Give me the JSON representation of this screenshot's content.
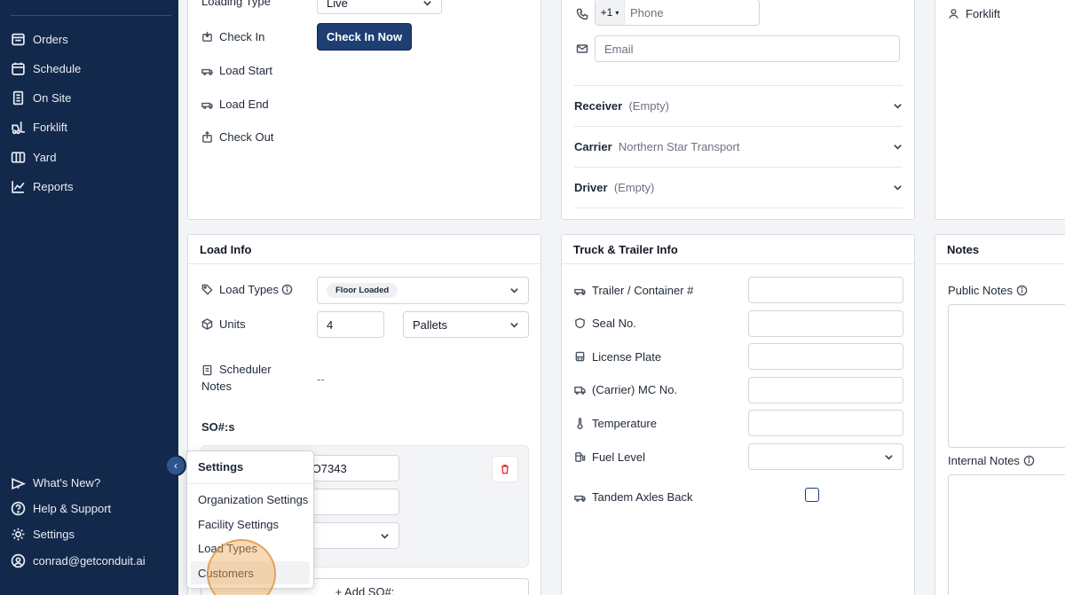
{
  "sidebar": {
    "items": [
      {
        "label": "Orders",
        "icon": "orders-icon"
      },
      {
        "label": "Schedule",
        "icon": "calendar-icon"
      },
      {
        "label": "On Site",
        "icon": "building-icon"
      },
      {
        "label": "Forklift",
        "icon": "forklift-icon"
      },
      {
        "label": "Yard",
        "icon": "yard-icon"
      },
      {
        "label": "Reports",
        "icon": "chart-line-icon"
      }
    ],
    "bottom": [
      {
        "label": "What's New?",
        "icon": "megaphone-icon"
      },
      {
        "label": "Help & Support",
        "icon": "help-circle-icon"
      },
      {
        "label": "Settings",
        "icon": "gear-icon"
      },
      {
        "label": "conrad@getconduit.ai",
        "icon": "user-circle-icon"
      }
    ],
    "collapse_glyph": "‹"
  },
  "top_left": {
    "loading_type_label": "Loading Type",
    "loading_type_value": "Live",
    "check_in_label": "Check In",
    "check_in_button": "Check In Now",
    "load_start_label": "Load Start",
    "load_end_label": "Load End",
    "check_out_label": "Check Out"
  },
  "top_middle": {
    "phone_prefix": "+1",
    "phone_placeholder": "Phone",
    "email_placeholder": "Email",
    "receiver_label": "Receiver",
    "receiver_value": "(Empty)",
    "carrier_label": "Carrier",
    "carrier_value": "Northern Star Transport",
    "driver_label": "Driver",
    "driver_value": "(Empty)"
  },
  "top_right": {
    "forklift_label": "Forklift"
  },
  "load_info": {
    "title": "Load Info",
    "load_types_label": "Load Types",
    "load_types_value": "Floor Loaded",
    "units_label": "Units",
    "units_value": "4",
    "units_type": "Pallets",
    "scheduler_notes_label_1": "Scheduler",
    "scheduler_notes_label_2": "Notes",
    "scheduler_notes_value": "--",
    "so_label": "SO#:s",
    "so_value": "PO7343",
    "add_so": "+ Add SO#:"
  },
  "truck_info": {
    "title": "Truck & Trailer Info",
    "fields": [
      {
        "label": "Trailer / Container #"
      },
      {
        "label": "Seal No."
      },
      {
        "label": "License Plate"
      },
      {
        "label": "(Carrier) MC No."
      },
      {
        "label": "Temperature"
      }
    ],
    "fuel_level_label": "Fuel Level",
    "tandem_label": "Tandem Axles Back"
  },
  "notes": {
    "title": "Notes",
    "public_label": "Public Notes",
    "internal_label": "Internal Notes"
  },
  "settings_menu": {
    "title": "Settings",
    "items": [
      "Organization Settings",
      "Facility Settings",
      "Load Types",
      "Customers"
    ]
  },
  "colors": {
    "sidebar_bg": "#13294b",
    "primary": "#1e3f73",
    "delete": "#dc2626",
    "cursor": "#f0aa5a"
  }
}
